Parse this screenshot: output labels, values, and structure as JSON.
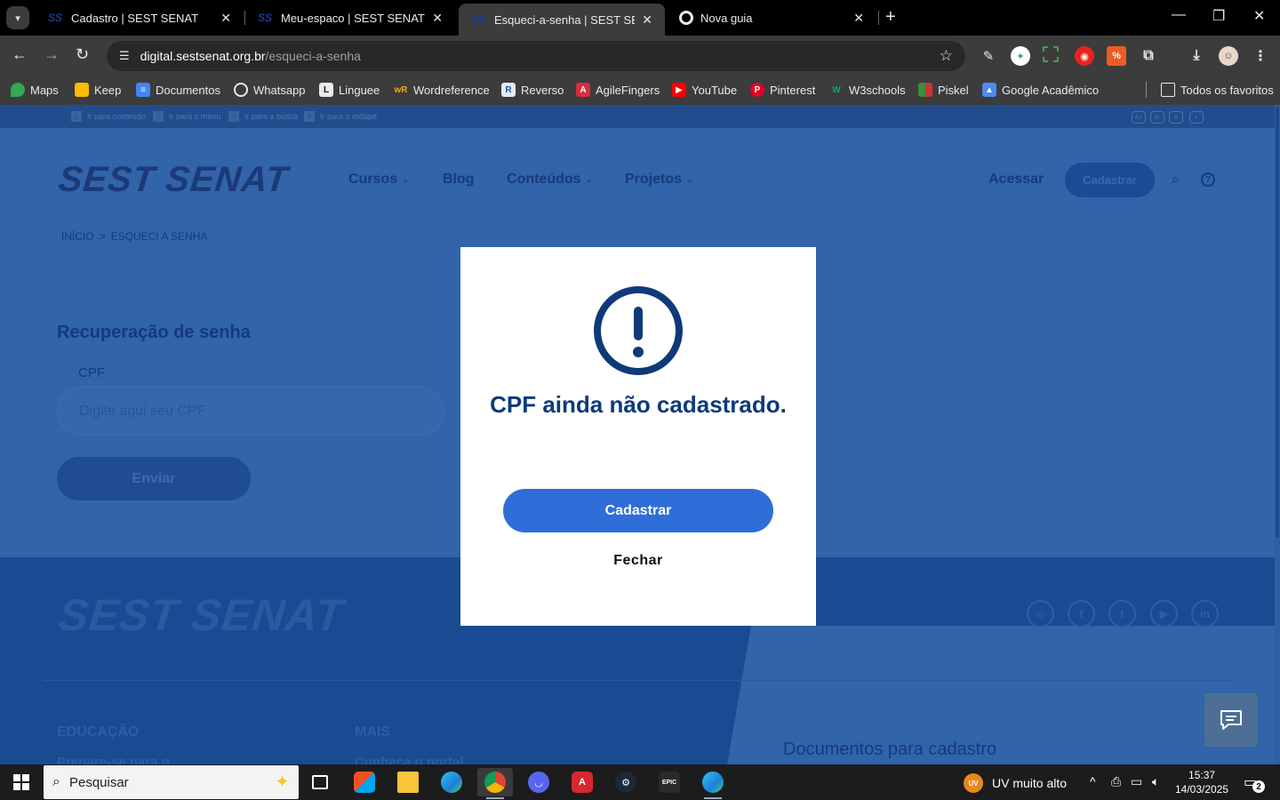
{
  "browser": {
    "tabs": [
      {
        "title": "Cadastro | SEST SENAT",
        "favicon": "ss-icon",
        "active": false
      },
      {
        "title": "Meu-espaco | SEST SENAT",
        "favicon": "ss-icon",
        "active": false
      },
      {
        "title": "Esqueci-a-senha | SEST SENAT",
        "favicon": "ss-icon",
        "active": true
      },
      {
        "title": "Nova guia",
        "favicon": "chrome-icon",
        "active": false
      }
    ],
    "url_host": "digital.sestsenat.org.br",
    "url_path": "/esqueci-a-senha",
    "bookmarks": [
      "Maps",
      "Keep",
      "Documentos",
      "Whatsapp",
      "Linguee",
      "Wordreference",
      "Reverso",
      "AgileFingers",
      "YouTube",
      "Pinterest",
      "W3schools",
      "Piskel",
      "Google Acadêmico"
    ],
    "all_bookmarks": "Todos os favoritos"
  },
  "page": {
    "skip_links": [
      "Ir para conteúdo",
      "Ir para o menu",
      "Ir para a busca",
      "Ir para o rodapé"
    ],
    "skip_numbers": [
      "1",
      "2",
      "3",
      "4"
    ],
    "a11y_controls": [
      "A+",
      "a-",
      "A",
      "◐"
    ],
    "logo": "SEST SENAT",
    "nav": [
      "Cursos",
      "Blog",
      "Conteúdos",
      "Projetos"
    ],
    "acessar": "Acessar",
    "cadastrar": "Cadastrar",
    "breadcrumb": {
      "home": "INÍCIO",
      "sep": ">",
      "current": "ESQUECI A SENHA"
    },
    "form": {
      "title": "Recuperação de senha",
      "cpf_label": "CPF",
      "cpf_placeholder": "Digite aqui seu CPF",
      "submit": "Enviar"
    },
    "footer": {
      "logo": "SEST SENAT",
      "col1_title": "EDUCAÇÃO",
      "col1_item": "Prepare-se para o",
      "col2_title": "MAIS",
      "col2_item": "Conheça o portal",
      "docs": "Documentos para cadastro",
      "social": [
        "instagram",
        "facebook",
        "twitter",
        "youtube",
        "linkedin"
      ]
    }
  },
  "modal": {
    "title": "CPF ainda não cadastrado.",
    "primary": "Cadastrar",
    "secondary": "Fechar",
    "icon": "exclamation-circle-icon"
  },
  "taskbar": {
    "search_placeholder": "Pesquisar",
    "weather": "UV muito alto",
    "weather_badge": "UV",
    "time": "15:37",
    "date": "14/03/2025",
    "notifications": "2"
  },
  "colors": {
    "overlay_blue": "#3164a8",
    "brand_navy": "#0e3a7a",
    "primary_button": "#2f6ed8"
  }
}
